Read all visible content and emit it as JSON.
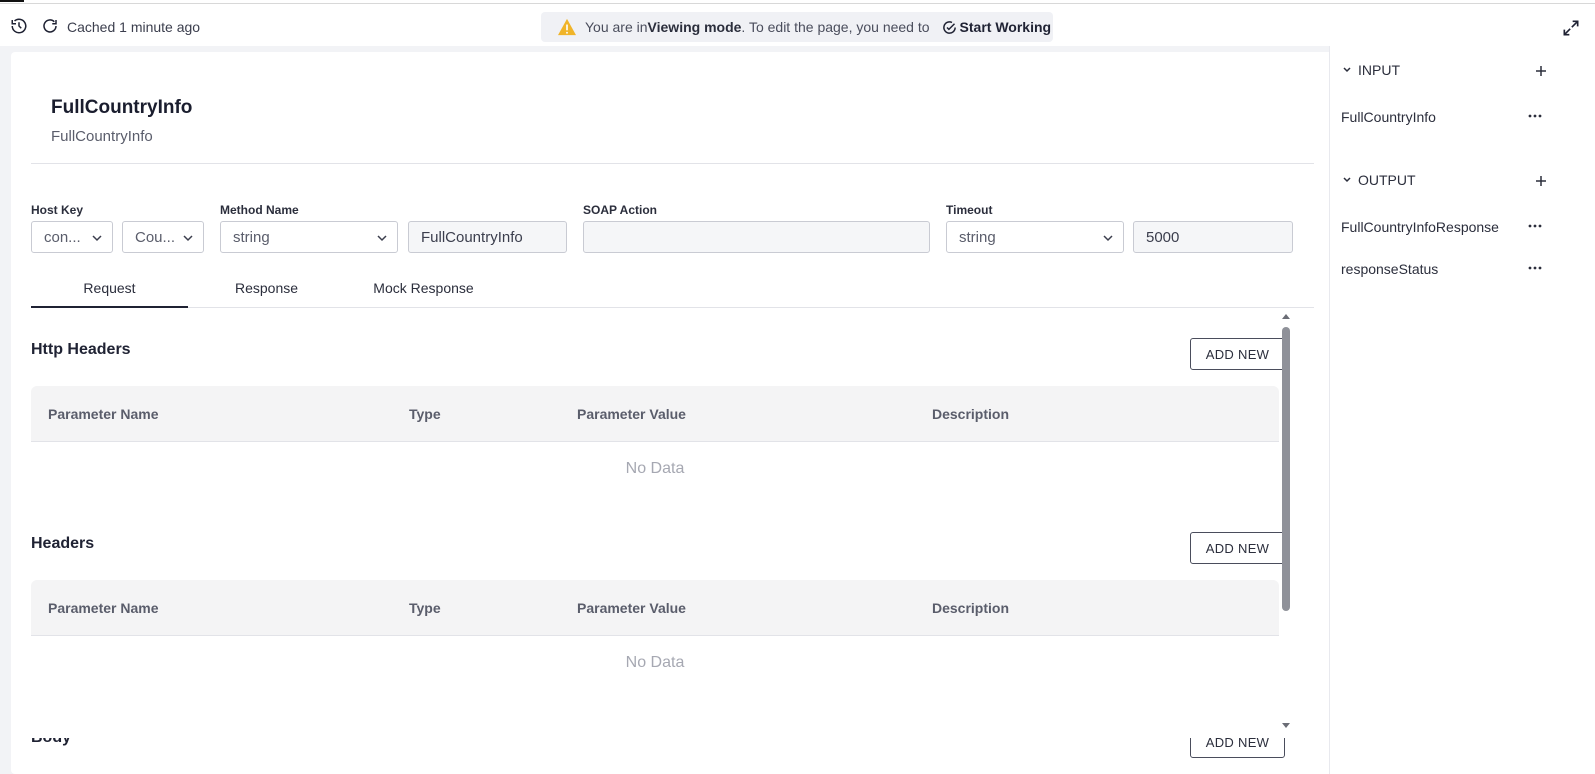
{
  "toolbar": {
    "cached_text": "Cached 1 minute ago",
    "banner": {
      "prefix": "You are in ",
      "mode": "Viewing mode",
      "suffix": ". To edit the page, you need to",
      "action": "Start Working"
    }
  },
  "page": {
    "title": "FullCountryInfo",
    "subtitle": "FullCountryInfo"
  },
  "form": {
    "host_key_label": "Host Key",
    "host_key_value1": "con...",
    "host_key_value2": "Cou...",
    "method_name_label": "Method Name",
    "method_type": "string",
    "method_value": "FullCountryInfo",
    "soap_action_label": "SOAP Action",
    "soap_action_value": "",
    "timeout_label": "Timeout",
    "timeout_type": "string",
    "timeout_value": "5000"
  },
  "tabs": [
    {
      "label": "Request",
      "active": true
    },
    {
      "label": "Response",
      "active": false
    },
    {
      "label": "Mock Response",
      "active": false
    }
  ],
  "sections": {
    "http_headers": {
      "title": "Http Headers",
      "add_label": "ADD NEW",
      "columns": [
        "Parameter Name",
        "Type",
        "Parameter Value",
        "Description"
      ],
      "empty": "No Data"
    },
    "headers": {
      "title": "Headers",
      "add_label": "ADD NEW",
      "columns": [
        "Parameter Name",
        "Type",
        "Parameter Value",
        "Description"
      ],
      "empty": "No Data"
    },
    "body": {
      "title": "Body",
      "add_label": "ADD NEW"
    }
  },
  "right_panel": {
    "input": {
      "label": "INPUT",
      "items": [
        "FullCountryInfo"
      ]
    },
    "output": {
      "label": "OUTPUT",
      "items": [
        "FullCountryInfoResponse",
        "responseStatus"
      ]
    }
  },
  "colors": {
    "accent": "#1f2233",
    "warning": "#f0b429",
    "muted": "#a6a8b2"
  }
}
